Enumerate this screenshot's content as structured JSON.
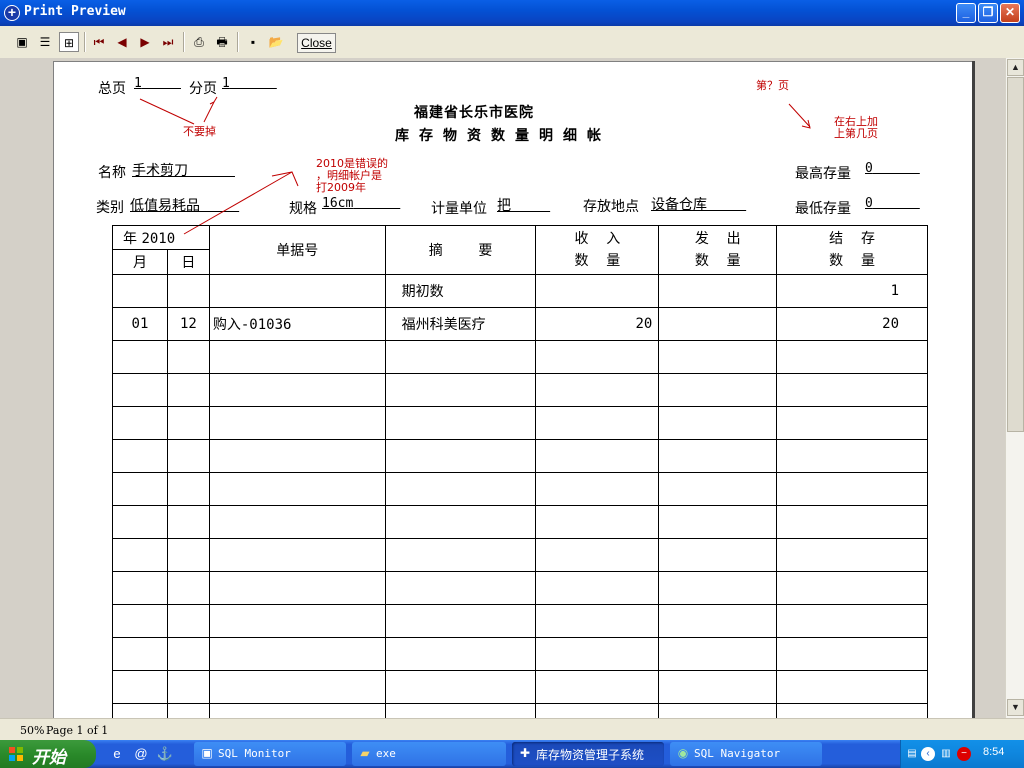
{
  "window": {
    "title": "Print Preview",
    "btn_min": "_",
    "btn_max": "❐",
    "btn_close": "✕"
  },
  "toolbar": {
    "close_label": "Close",
    "icons": [
      "whole-page-icon",
      "page-width-icon",
      "zoom-icon",
      "first-page-icon",
      "prev-page-icon",
      "next-page-icon",
      "last-page-icon",
      "print-setup-icon",
      "print-icon",
      "save-icon",
      "open-icon"
    ]
  },
  "report": {
    "total_pages_label": "总页",
    "total_pages_value": "1",
    "sub_page_label": "分页",
    "sub_page_value": "1",
    "hospital": "福建省长乐市医院",
    "title": "库存物资数量明细帐",
    "name_label": "名称",
    "name_value": "手术剪刀",
    "category_label": "类别",
    "category_value": "低值易耗品",
    "spec_label": "规格",
    "spec_value": "16cm",
    "unit_label": "计量单位",
    "unit_value": "把",
    "location_label": "存放地点",
    "location_value": "设备仓库",
    "max_stock_label": "最高存量",
    "max_stock_value": "0",
    "min_stock_label": "最低存量",
    "min_stock_value": "0"
  },
  "annotations": {
    "no_need": "不要掉",
    "page_n": "第？页",
    "add_top_right_1": "在右上加",
    "add_top_right_2": "上第几页",
    "year_error_1": "2010是错误的",
    "year_error_2": "，明细帐户是",
    "year_error_3": "打2009年"
  },
  "table": {
    "year_label": "年",
    "year_value": "2010",
    "month_label": "月",
    "day_label": "日",
    "doc_no_label": "单据号",
    "summary_label": "摘        要",
    "in_label_1": "收    入",
    "in_label_2": "数    量",
    "out_label_1": "发    出",
    "out_label_2": "数    量",
    "bal_label_1": "结    存",
    "bal_label_2": "数    量",
    "rows": [
      {
        "month": "",
        "day": "",
        "doc": "",
        "summary": "期初数",
        "in": "",
        "out": "",
        "balance": "1"
      },
      {
        "month": "01",
        "day": "12",
        "doc": "购入-01036",
        "summary": "福州科美医疗",
        "in": "20",
        "out": "",
        "balance": "20"
      },
      {
        "month": "",
        "day": "",
        "doc": "",
        "summary": "",
        "in": "",
        "out": "",
        "balance": ""
      },
      {
        "month": "",
        "day": "",
        "doc": "",
        "summary": "",
        "in": "",
        "out": "",
        "balance": ""
      },
      {
        "month": "",
        "day": "",
        "doc": "",
        "summary": "",
        "in": "",
        "out": "",
        "balance": ""
      },
      {
        "month": "",
        "day": "",
        "doc": "",
        "summary": "",
        "in": "",
        "out": "",
        "balance": ""
      },
      {
        "month": "",
        "day": "",
        "doc": "",
        "summary": "",
        "in": "",
        "out": "",
        "balance": ""
      },
      {
        "month": "",
        "day": "",
        "doc": "",
        "summary": "",
        "in": "",
        "out": "",
        "balance": ""
      },
      {
        "month": "",
        "day": "",
        "doc": "",
        "summary": "",
        "in": "",
        "out": "",
        "balance": ""
      },
      {
        "month": "",
        "day": "",
        "doc": "",
        "summary": "",
        "in": "",
        "out": "",
        "balance": ""
      },
      {
        "month": "",
        "day": "",
        "doc": "",
        "summary": "",
        "in": "",
        "out": "",
        "balance": ""
      },
      {
        "month": "",
        "day": "",
        "doc": "",
        "summary": "",
        "in": "",
        "out": "",
        "balance": ""
      },
      {
        "month": "",
        "day": "",
        "doc": "",
        "summary": "",
        "in": "",
        "out": "",
        "balance": ""
      },
      {
        "month": "",
        "day": "",
        "doc": "",
        "summary": "",
        "in": "",
        "out": "",
        "balance": ""
      }
    ]
  },
  "status": {
    "zoom": "50%",
    "page": "Page 1 of 1"
  },
  "taskbar": {
    "start_label": "开始",
    "tasks": [
      {
        "label": "SQL Monitor",
        "icon": "sql-monitor-icon"
      },
      {
        "label": "exe",
        "icon": "folder-icon"
      },
      {
        "label": "库存物资管理子系统",
        "icon": "app-icon"
      },
      {
        "label": "SQL Navigator",
        "icon": "sql-navigator-icon"
      }
    ],
    "clock": "8:54"
  },
  "colors": {
    "titlebar": "#0a5fe6",
    "annotation": "#c00000",
    "taskbar": "#245edb",
    "start": "#2a8a2a"
  }
}
